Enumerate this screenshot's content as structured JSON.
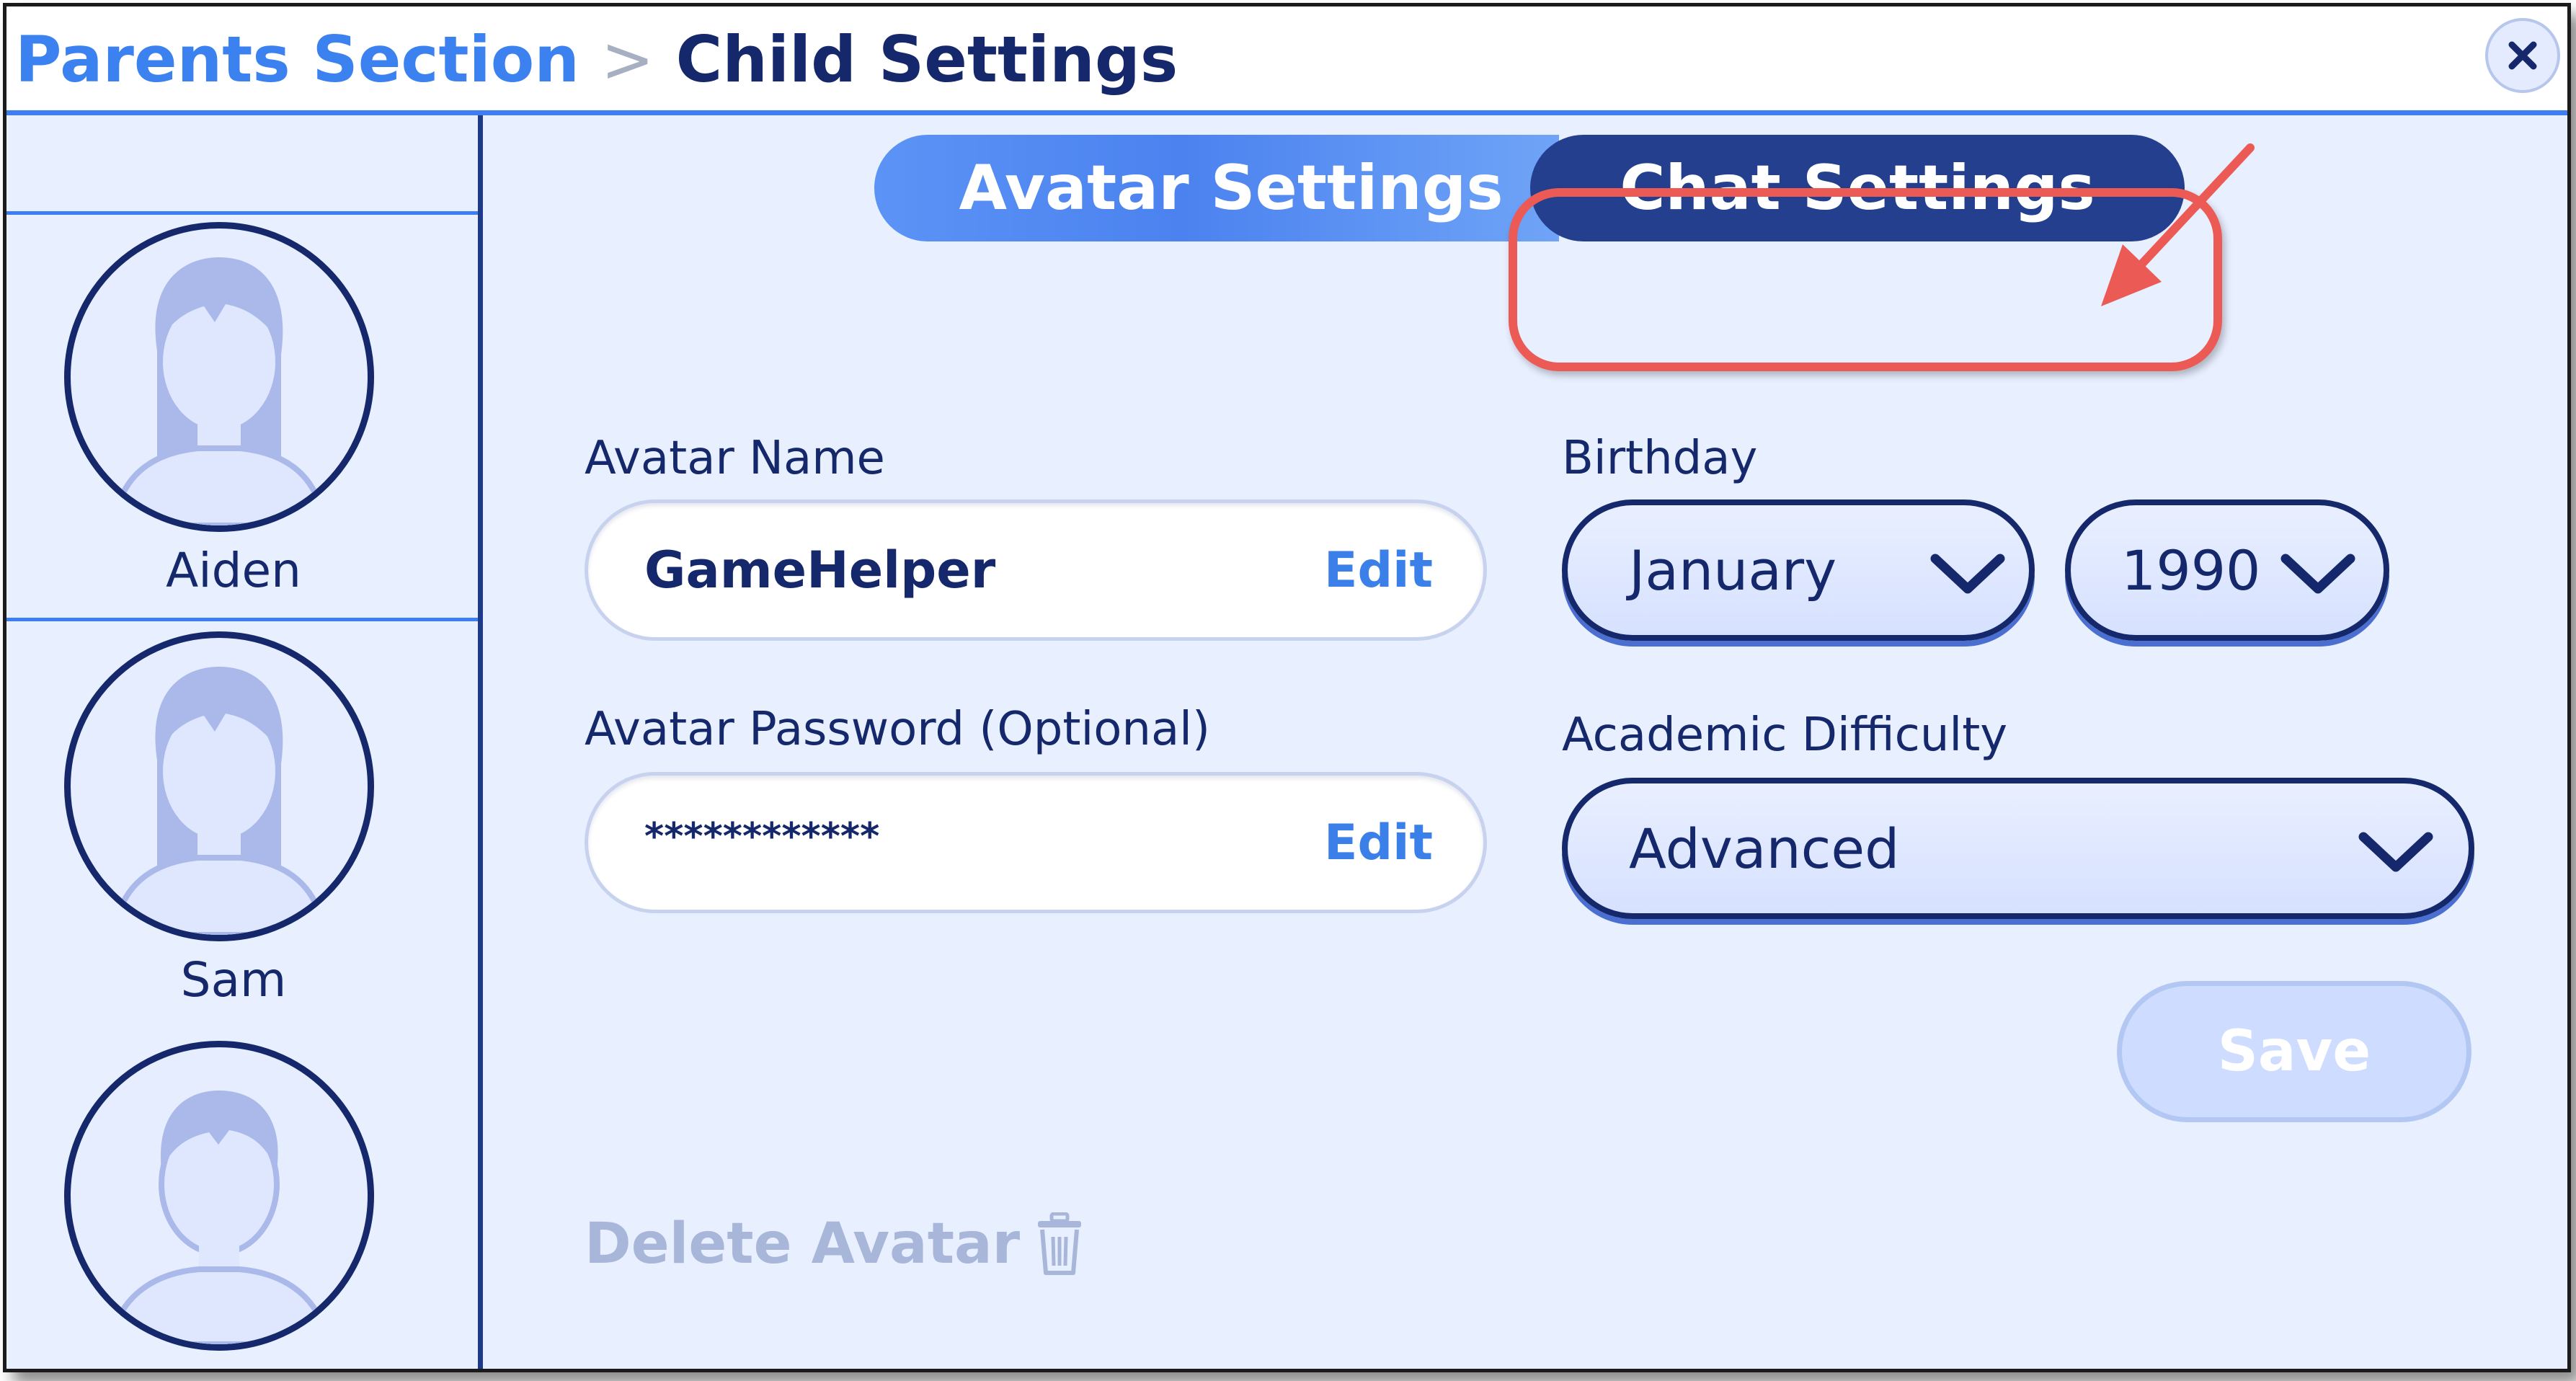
{
  "header": {
    "breadcrumb_root": "Parents Section",
    "breadcrumb_separator": ">",
    "breadcrumb_current": "Child Settings",
    "close_icon": "close-icon"
  },
  "sidebar": {
    "children": [
      {
        "name": "Aiden",
        "avatar_icon": "female-avatar-icon"
      },
      {
        "name": "Sam",
        "avatar_icon": "female-avatar-icon"
      },
      {
        "name": "",
        "avatar_icon": "male-avatar-icon"
      }
    ]
  },
  "tabs": {
    "items": [
      {
        "label": "Avatar Settings",
        "active": false
      },
      {
        "label": "Chat Settings",
        "active": true
      }
    ],
    "annotation": {
      "type": "highlight-box-with-arrow",
      "color": "#ec5a55",
      "target": "Chat Settings"
    }
  },
  "form": {
    "avatar_name": {
      "label": "Avatar Name",
      "value": "GameHelper",
      "action": "Edit"
    },
    "avatar_password": {
      "label": "Avatar Password (Optional)",
      "value": "************",
      "action": "Edit"
    },
    "birthday": {
      "label": "Birthday",
      "month": "January",
      "year": "1990"
    },
    "academic_difficulty": {
      "label": "Academic Difficulty",
      "value": "Advanced"
    },
    "save_label": "Save",
    "delete_label": "Delete Avatar",
    "delete_icon": "trash-icon"
  },
  "colors": {
    "navy": "#14286b",
    "accent_blue": "#3b82f0",
    "panel_bg": "#e8efff",
    "annotation_red": "#ec5a55"
  }
}
